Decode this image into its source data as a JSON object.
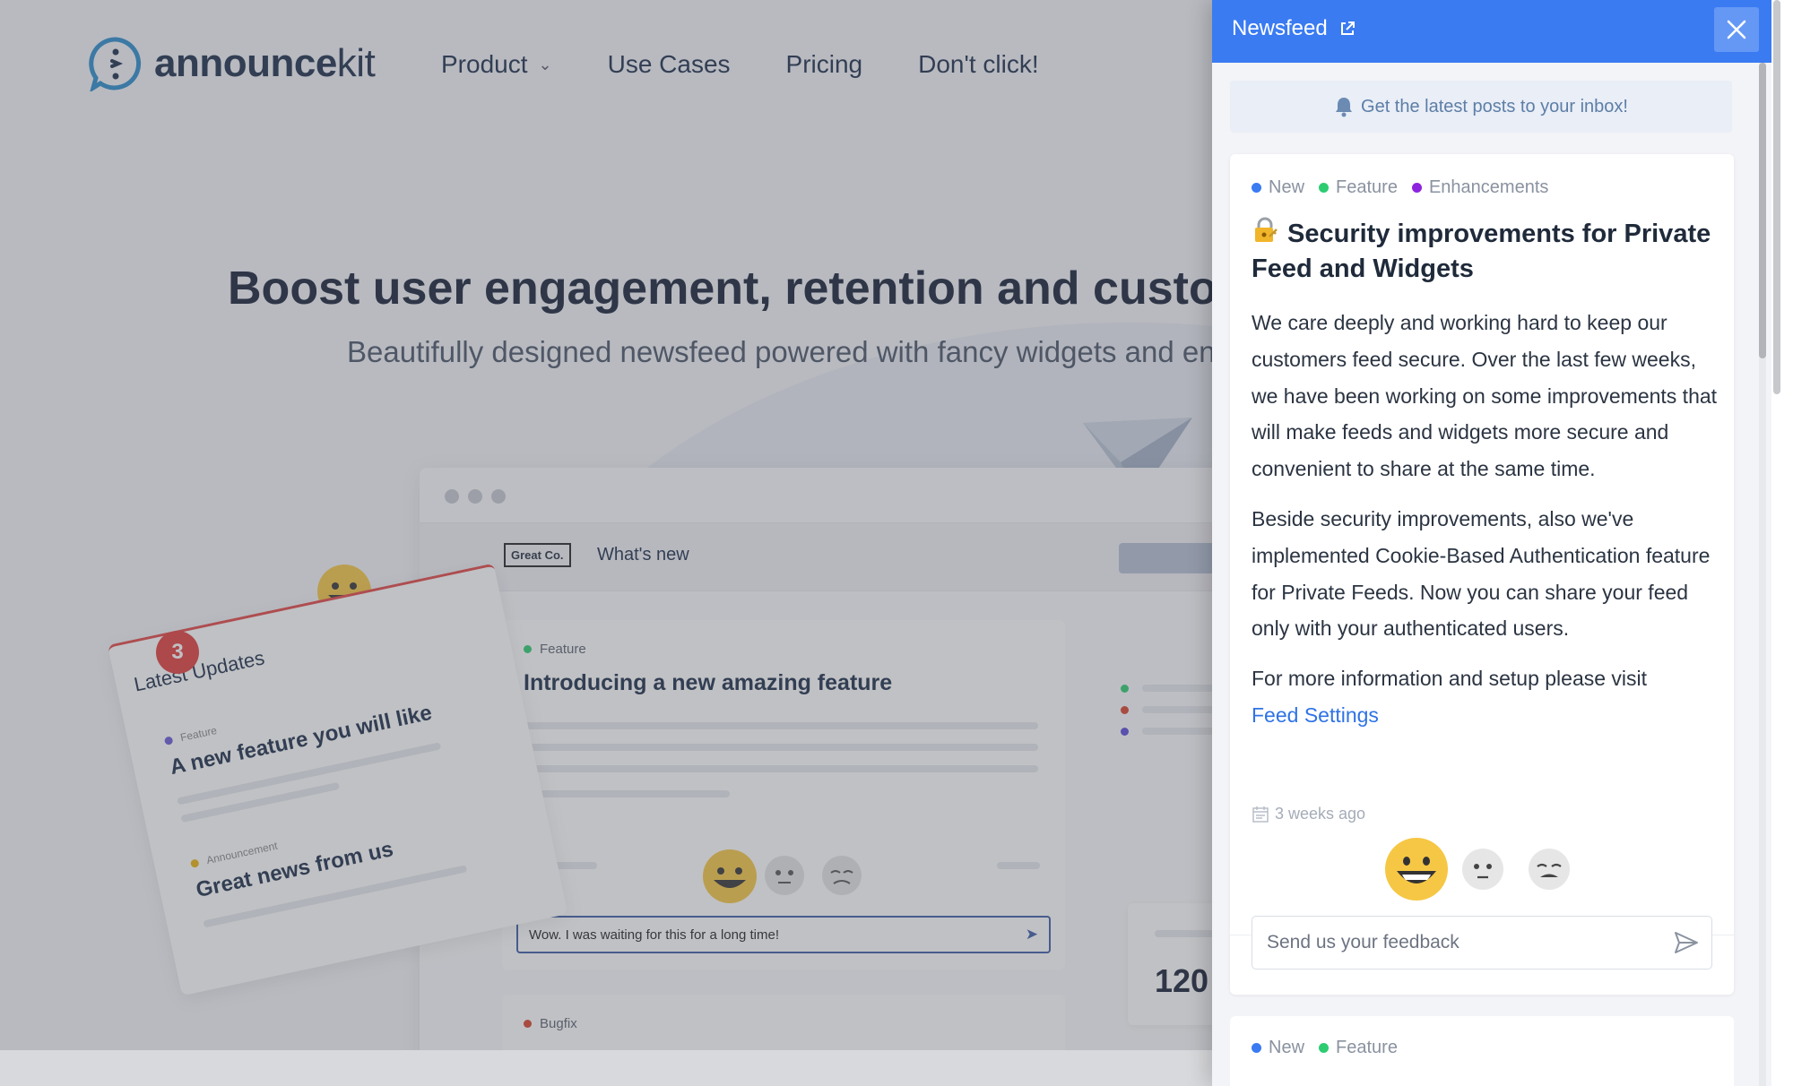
{
  "site": {
    "logo_text_bold": "announce",
    "logo_text_light": "kit",
    "nav": [
      {
        "label": "Product",
        "has_dropdown": true
      },
      {
        "label": "Use Cases",
        "has_dropdown": false
      },
      {
        "label": "Pricing",
        "has_dropdown": false
      },
      {
        "label": "Don't click!",
        "has_dropdown": false
      }
    ],
    "hero_title": "Boost user engagement, retention and custom",
    "hero_subtitle": "Beautifully designed newsfeed powered with fancy widgets and en",
    "mock": {
      "brand": "Great Co.",
      "header": "What's new",
      "card_tag": "Feature",
      "card_title": "Introducing a new amazing feature",
      "card_input": "Wow. I was waiting for this for a long time!",
      "card2_tag": "Bugfix",
      "counter": "120"
    },
    "latest_updates": {
      "badge": "3",
      "title": "Latest Updates",
      "item1_tag": "Feature",
      "item1_title": "A new feature you will like",
      "item2_tag": "Announcement",
      "item2_title": "Great news from us"
    }
  },
  "newsfeed": {
    "title": "Newsfeed",
    "header_color": "#3a7bf2",
    "subscribe": "Get the latest posts to your inbox!",
    "post": {
      "tags": [
        {
          "label": "New",
          "color": "#3a7bf2"
        },
        {
          "label": "Feature",
          "color": "#2ecc71"
        },
        {
          "label": "Enhancements",
          "color": "#8e24dd"
        }
      ],
      "title": "Security improvements for Private Feed and Widgets",
      "paragraph_1": "We care deeply and working hard to keep our customers feed secure. Over the last few weeks, we have been working on some improvements that will make feeds and widgets more secure and convenient to share at the same time.",
      "paragraph_2": "Beside security improvements, also we've implemented Cookie-Based Authentication feature for Private Feeds. Now you can share your feed only with your authenticated users.",
      "paragraph_3": "For more information and setup please visit",
      "link": "Feed Settings",
      "date": "3 weeks ago",
      "feedback_placeholder": "Send us your feedback"
    },
    "post2": {
      "tags": [
        {
          "label": "New",
          "color": "#3a7bf2"
        },
        {
          "label": "Feature",
          "color": "#2ecc71"
        }
      ]
    }
  }
}
